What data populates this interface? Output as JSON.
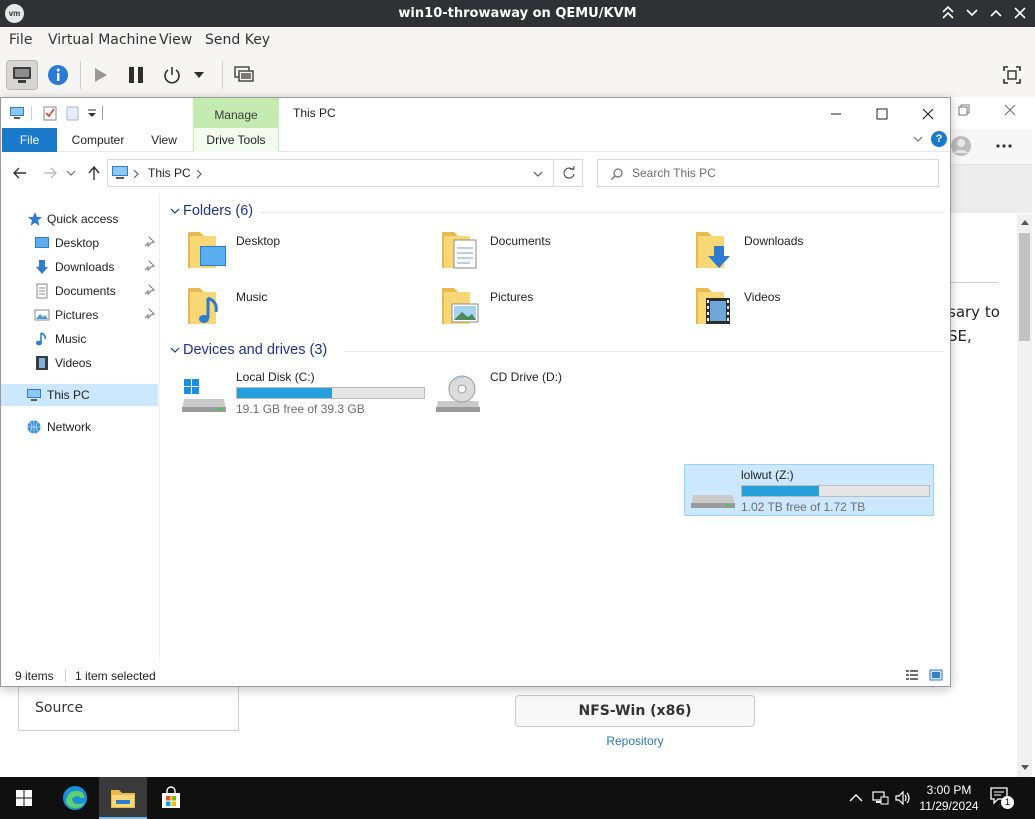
{
  "vm": {
    "title": "win10-throwaway on QEMU/KVM",
    "logo": "vm",
    "menu": [
      "File",
      "Virtual Machine",
      "View",
      "Send Key"
    ]
  },
  "explorer": {
    "title": "This PC",
    "manage_tab": "Manage",
    "ribbon_tabs": {
      "file": "File",
      "computer": "Computer",
      "view": "View",
      "drive_tools": "Drive Tools"
    },
    "help": "?",
    "breadcrumb": "This PC",
    "search_placeholder": "Search This PC",
    "nav": {
      "quick_access": "Quick access",
      "desktop": "Desktop",
      "downloads": "Downloads",
      "documents": "Documents",
      "pictures": "Pictures",
      "music": "Music",
      "videos": "Videos",
      "this_pc": "This PC",
      "network": "Network"
    },
    "folders_header": "Folders (6)",
    "folders": [
      "Desktop",
      "Documents",
      "Downloads",
      "Music",
      "Pictures",
      "Videos"
    ],
    "drives_header": "Devices and drives (3)",
    "drives": [
      {
        "name": "Local Disk (C:)",
        "free": "19.1 GB free of 39.3 GB",
        "used_fraction": 0.51
      },
      {
        "name": "CD Drive (D:)"
      },
      {
        "name": "lolwut (Z:)",
        "free": "1.02 TB free of 1.72 TB",
        "used_fraction": 0.41
      }
    ],
    "status": {
      "count": "9 items",
      "selected": "1 item selected"
    }
  },
  "background_page": {
    "text_line1": "sary to",
    "text_line2": "SE,",
    "source_label": "Source",
    "button_label": "NFS-Win (x86)",
    "link_label": "Repository"
  },
  "taskbar": {
    "time": "3:00 PM",
    "date": "11/29/2024",
    "notification_count": "1"
  },
  "colors": {
    "accent": "#1979ca",
    "selection": "#cce8ff",
    "drive_bar": "#26a0da",
    "manage_tab": "#c4ecb0",
    "group_header": "#1e3287"
  }
}
